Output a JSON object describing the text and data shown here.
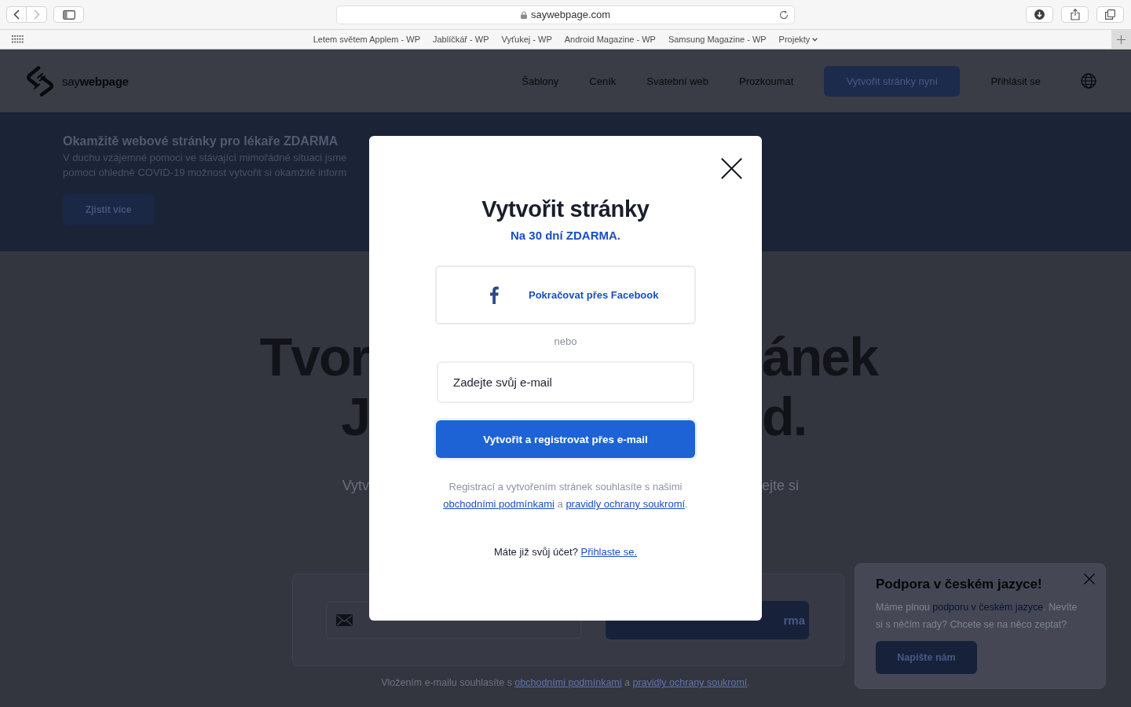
{
  "browser": {
    "navigation": {
      "back_disabled": false,
      "forward_disabled": true
    },
    "address": "saywebpage.com",
    "bookmarks": [
      {
        "label": "Letem světem Applem - WP",
        "kind": "link"
      },
      {
        "label": "Jablíčkář - WP",
        "kind": "link"
      },
      {
        "label": "Vyťukej - WP",
        "kind": "link"
      },
      {
        "label": "Android Magazine - WP",
        "kind": "link"
      },
      {
        "label": "Samsung Magazine - WP",
        "kind": "link"
      },
      {
        "label": "Projekty",
        "kind": "folder"
      }
    ]
  },
  "site_header": {
    "logo": "say**webpage**",
    "nav": [
      "Šablony",
      "Ceník",
      "Svatební web",
      "Prozkoumat"
    ],
    "cta_button": "Vytvořit stránky nyní",
    "login_link": "Přihlásit se"
  },
  "banner": {
    "title": "Okamžitě webové stránky pro lékaře ZDARMA",
    "lines": [
      "V duchu vzájemné pomoci ve stávající mimořádné situaci jsme",
      "pomoci ohledně COVID-19 možnost vytvořit si okamžitě inform"
    ],
    "button": "Zjistit více"
  },
  "hero": {
    "headline_rows": [
      {
        "left": "Tvor",
        "right": "ánek"
      },
      {
        "left": "J",
        "right": "d."
      }
    ],
    "subtitle": {
      "left": "Vytv",
      "right": "ejte si"
    },
    "signup": {
      "button": "rma"
    },
    "consent_note": [
      {
        "kind": "text",
        "text": "Vložením e-mailu souhlasíte s "
      },
      {
        "kind": "link",
        "text": "obchodními podmínkami"
      },
      {
        "kind": "text",
        "text": " a "
      },
      {
        "kind": "link",
        "text": "pravidly ochrany soukromí"
      },
      {
        "kind": "text",
        "text": "."
      }
    ]
  },
  "chat_popup": {
    "title": "Podpora v českém jazyce!",
    "message": [
      {
        "kind": "text",
        "text": "Máme plnou "
      },
      {
        "kind": "link",
        "text": "podporu v českém jazyce"
      },
      {
        "kind": "text",
        "text": ". Nevíte si s něčím rady? Chcete se na něco zeptat?"
      }
    ],
    "button": "Napište nám"
  },
  "modal": {
    "title": "Vytvořit stránky",
    "subtitle": "Na 30 dní ZDARMA.",
    "facebook_button": "Pokračovat přes Facebook",
    "divider": "nebo",
    "email": {
      "placeholder": "Zadejte svůj e-mail"
    },
    "submit_button": "Vytvořit a registrovat přes e-mail",
    "terms": [
      {
        "kind": "text",
        "text": "Registrací a vytvořením stránek souhlasíte s našimi "
      },
      {
        "kind": "link",
        "text": "obchodními podmínkami"
      },
      {
        "kind": "text",
        "text": " a "
      },
      {
        "kind": "link",
        "text": "pravidly ochrany soukromí"
      },
      {
        "kind": "text",
        "text": "."
      }
    ],
    "login_prompt": [
      {
        "kind": "text",
        "text": "Máte již svůj účet? "
      },
      {
        "kind": "link",
        "text": "Přihlaste se."
      }
    ]
  }
}
